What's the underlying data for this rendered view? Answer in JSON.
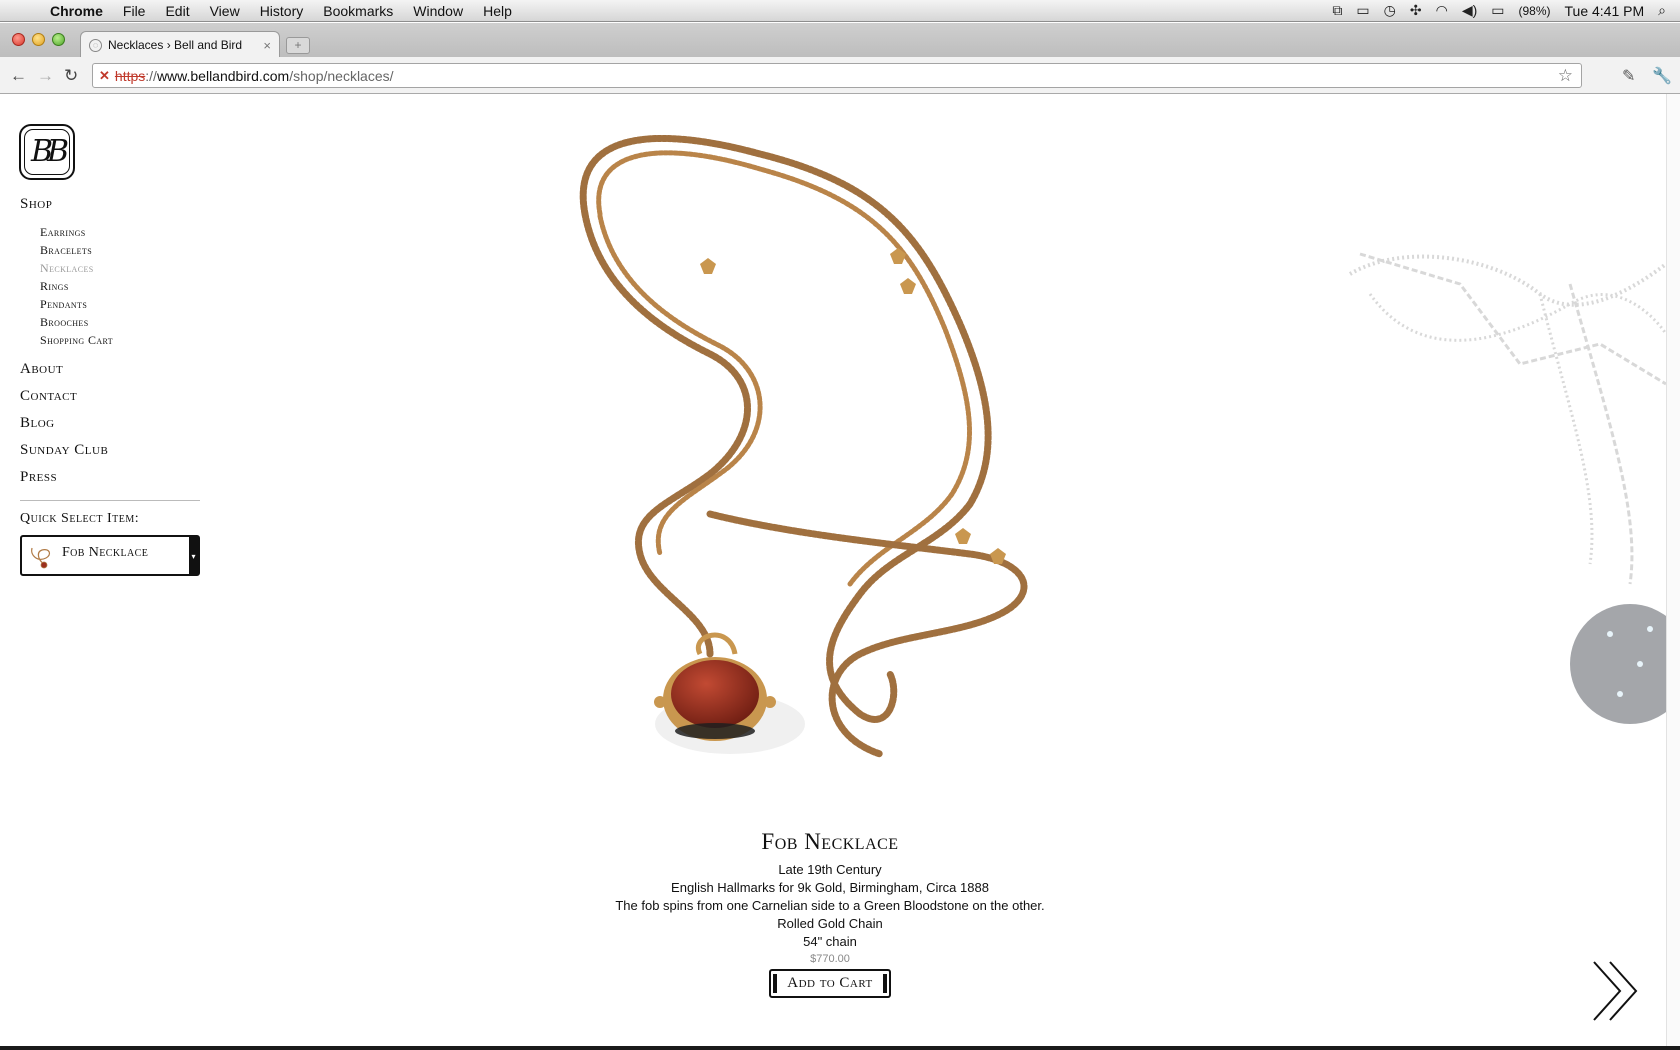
{
  "menubar": {
    "app": "Chrome",
    "items": [
      "File",
      "Edit",
      "View",
      "History",
      "Bookmarks",
      "Window",
      "Help"
    ],
    "battery": "(98%)",
    "clock": "Tue 4:41 PM"
  },
  "browser": {
    "tab_title": "Necklaces › Bell and Bird",
    "new_tab_label": "+",
    "url_scheme": "https",
    "url_sep": "://",
    "url_domain": "www.bellandbird.com",
    "url_path": "/shop/necklaces/"
  },
  "sidebar": {
    "logo_text": "BB",
    "shop": "Shop",
    "sub_items": [
      {
        "label": "Earrings",
        "active": false
      },
      {
        "label": "Bracelets",
        "active": false
      },
      {
        "label": "Necklaces",
        "active": true
      },
      {
        "label": "Rings",
        "active": false
      },
      {
        "label": "Pendants",
        "active": false
      },
      {
        "label": "Brooches",
        "active": false
      },
      {
        "label": "Shopping Cart",
        "active": false
      }
    ],
    "main_items": [
      "About",
      "Contact",
      "Blog",
      "Sunday Club",
      "Press"
    ],
    "quick_select_label": "Quick Select Item:",
    "quick_select_value": "Fob Necklace"
  },
  "product": {
    "title": "Fob Necklace",
    "lines": [
      "Late 19th Century",
      "English Hallmarks for 9k Gold, Birmingham, Circa 1888",
      "The fob spins from one Carnelian side to a Green Bloodstone on the other.",
      "Rolled Gold Chain",
      "54\" chain"
    ],
    "price": "$770.00",
    "cart_label": "Add to Cart"
  },
  "colors": {
    "gold": "#b07a45",
    "carnelian": "#9b2f1e",
    "silver": "#b9b9b9"
  }
}
